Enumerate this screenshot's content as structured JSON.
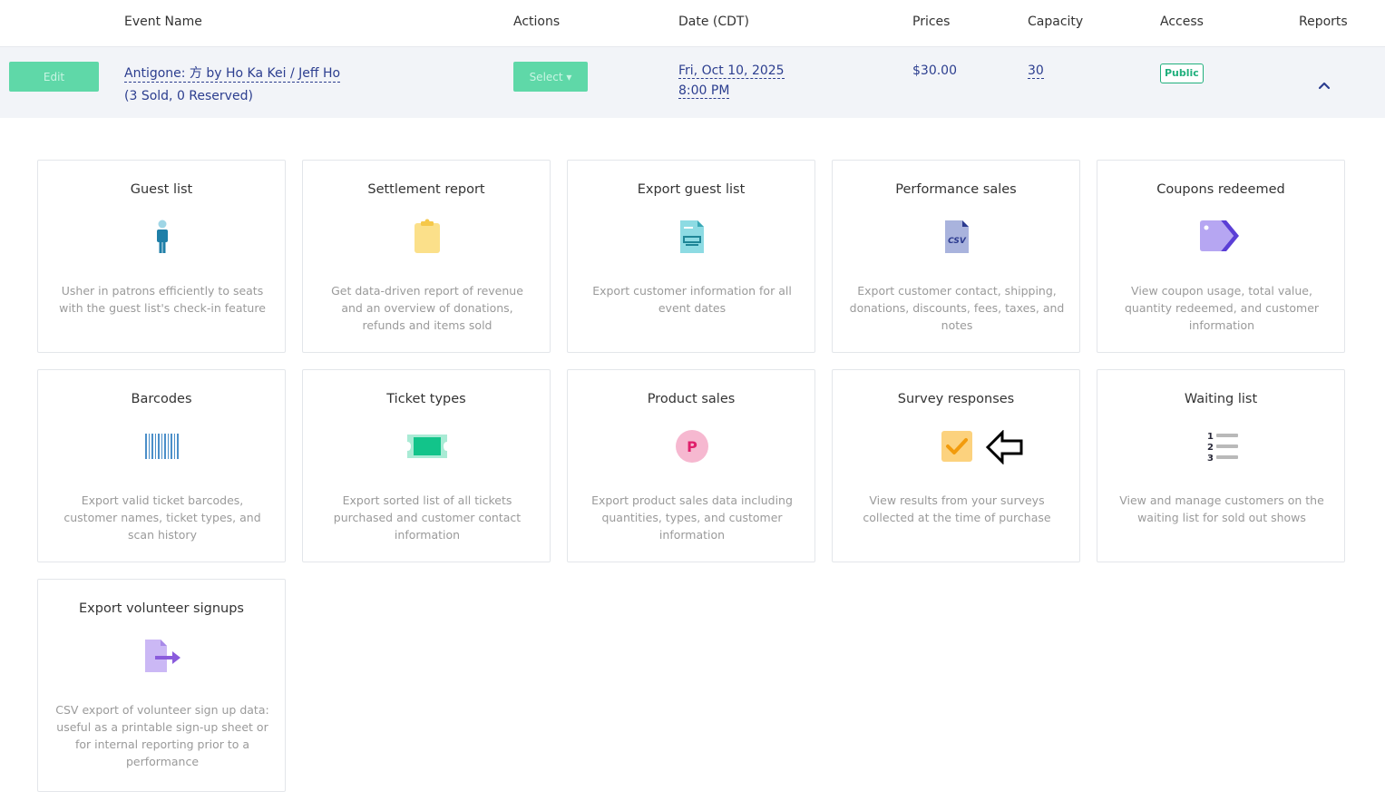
{
  "table": {
    "headers": {
      "event_name": "Event Name",
      "actions": "Actions",
      "date": "Date (CDT)",
      "prices": "Prices",
      "capacity": "Capacity",
      "access": "Access",
      "reports": "Reports"
    },
    "row": {
      "edit_label": "Edit",
      "event_name": "Antigone: 方 by Ho Ka Kei / Jeff Ho",
      "sold_reserved": "(3 Sold, 0 Reserved)",
      "select_label": "Select ▾",
      "date_line1": "Fri, Oct 10, 2025",
      "date_line2": "8:00 PM",
      "price": "$30.00",
      "capacity": "30",
      "access_badge": "Public",
      "reports_toggle_icon": "chevron-up-icon"
    }
  },
  "reports": [
    {
      "title": "Guest list",
      "icon": "person-icon",
      "desc": "Usher in patrons efficiently to seats with the guest list's check-in feature"
    },
    {
      "title": "Settlement report",
      "icon": "clipboard-icon",
      "desc": "Get data-driven report of revenue and an overview of donations, refunds and items sold"
    },
    {
      "title": "Export guest list",
      "icon": "document-export-icon",
      "desc": "Export customer information for all event dates"
    },
    {
      "title": "Performance sales",
      "icon": "csv-file-icon",
      "desc": "Export customer contact, shipping, donations, discounts, fees, taxes, and notes"
    },
    {
      "title": "Coupons redeemed",
      "icon": "coupon-tag-icon",
      "desc": "View coupon usage, total value, quantity redeemed, and customer information"
    },
    {
      "title": "Barcodes",
      "icon": "barcode-icon",
      "desc": "Export valid ticket barcodes, customer names, ticket types, and scan history"
    },
    {
      "title": "Ticket types",
      "icon": "ticket-icon",
      "desc": "Export sorted list of all tickets purchased and customer contact information"
    },
    {
      "title": "Product sales",
      "icon": "product-p-icon",
      "desc": "Export product sales data including quantities, types, and customer information"
    },
    {
      "title": "Survey responses",
      "icon": "checkbox-icon",
      "desc": "View results from your surveys collected at the time of purchase"
    },
    {
      "title": "Waiting list",
      "icon": "numbered-list-icon",
      "desc": "View and manage customers on the waiting list for sold out shows"
    },
    {
      "title": "Export volunteer signups",
      "icon": "file-arrow-icon",
      "desc": "CSV export of volunteer sign up data: useful as a printable sign-up sheet or for internal reporting prior to a performance"
    }
  ],
  "colors": {
    "accent_green": "#5fd8a8",
    "link_blue": "#2c3e8f",
    "public_green": "#21b07d"
  }
}
